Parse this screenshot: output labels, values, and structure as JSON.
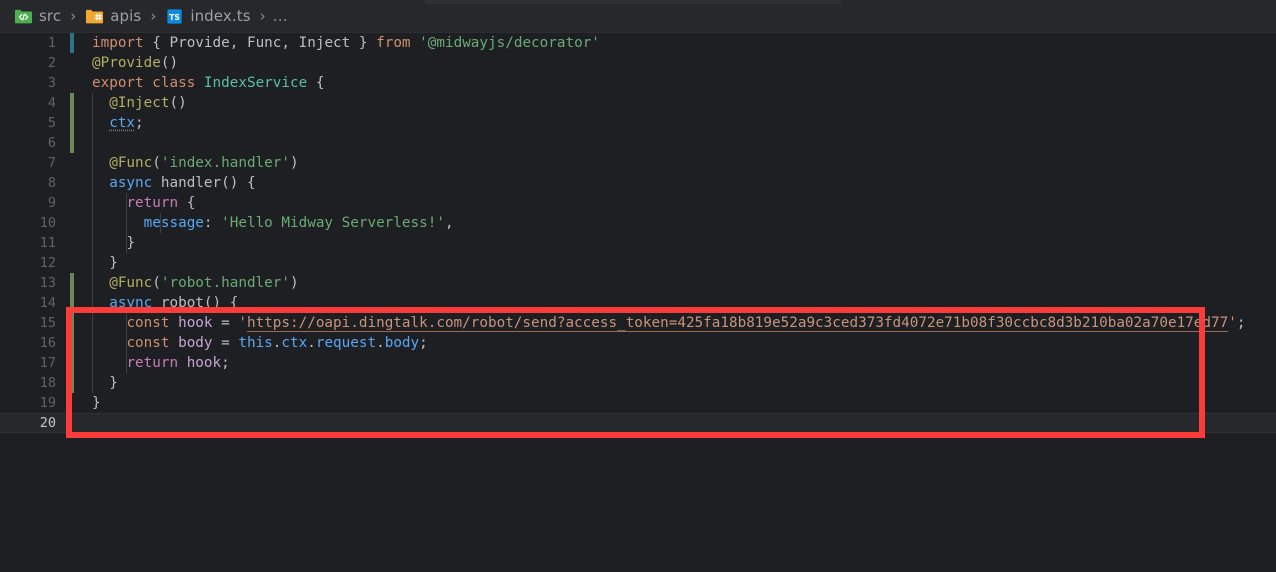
{
  "window": {
    "title": "index.ts"
  },
  "breadcrumb": {
    "items": [
      {
        "label": "src",
        "icon": "folder-src-icon"
      },
      {
        "label": "apis",
        "icon": "folder-apis-icon"
      },
      {
        "label": "index.ts",
        "icon": "typescript-file-icon"
      },
      {
        "label": "…",
        "icon": "ellipsis-icon"
      }
    ],
    "separator": "›"
  },
  "colors": {
    "editor_background": "#1e1f22",
    "breadcrumb_background": "#26282c",
    "annotation_red": "#fc3b3b",
    "gutter_modified": "#2b7489",
    "gutter_added": "#6a8759",
    "active_line": "#26282c",
    "string_green": "#6aab73",
    "string_url": "#c9937a",
    "keyword_orange": "#cf8e6d",
    "decorator_yellow": "#b3ae60",
    "class_teal": "#5bc0a8",
    "field_blue": "#56a8f5",
    "keyword_magenta": "#c77dbb"
  },
  "editor": {
    "active_line_number": 20,
    "annotation": {
      "name": "red-highlight-rectangle",
      "covers_lines": [
        13,
        14,
        15,
        16,
        17,
        18
      ]
    },
    "lines": [
      {
        "n": "1",
        "marker": "modified",
        "text": "import { Provide, Func, Inject } from '@midwayjs/decorator'"
      },
      {
        "n": "2",
        "marker": "none",
        "text": "@Provide()"
      },
      {
        "n": "3",
        "marker": "none",
        "text": "export class IndexService {"
      },
      {
        "n": "4",
        "marker": "added",
        "text": "  @Inject()"
      },
      {
        "n": "5",
        "marker": "added",
        "text": "  ctx;"
      },
      {
        "n": "6",
        "marker": "added",
        "text": ""
      },
      {
        "n": "7",
        "marker": "none",
        "text": "  @Func('index.handler')"
      },
      {
        "n": "8",
        "marker": "none",
        "text": "  async handler() {"
      },
      {
        "n": "9",
        "marker": "none",
        "text": "    return {"
      },
      {
        "n": "10",
        "marker": "none",
        "text": "      message: 'Hello Midway Serverless!',"
      },
      {
        "n": "11",
        "marker": "none",
        "text": "    }"
      },
      {
        "n": "12",
        "marker": "none",
        "text": "  }"
      },
      {
        "n": "13",
        "marker": "added",
        "text": "  @Func('robot.handler')"
      },
      {
        "n": "14",
        "marker": "added",
        "text": "  async robot() {"
      },
      {
        "n": "15",
        "marker": "added",
        "text": "    const hook = 'https://oapi.dingtalk.com/robot/send?access_token=425fa18b819e52a9c3ced373fd4072e71b08f30ccbc8d3b210ba02a70e17ed77';"
      },
      {
        "n": "16",
        "marker": "added",
        "text": "    const body = this.ctx.request.body;"
      },
      {
        "n": "17",
        "marker": "added",
        "text": "    return hook;"
      },
      {
        "n": "18",
        "marker": "added",
        "text": "  }"
      },
      {
        "n": "19",
        "marker": "none",
        "text": "}"
      },
      {
        "n": "20",
        "marker": "none",
        "text": ""
      }
    ],
    "url_value": "https://oapi.dingtalk.com/robot/send?access_token=425fa18b819e52a9c3ced373fd4072e71b08f30ccbc8d3b210ba02a70e17ed77",
    "tokens": {
      "import": "import",
      "from": "from",
      "export": "export",
      "class": "class",
      "async": "async",
      "const": "const",
      "return": "return",
      "this": "this",
      "class_name": "IndexService",
      "decorator_provide": "@Provide()",
      "decorator_inject": "@Inject()",
      "decorator_func_index": "@Func",
      "decorator_func_robot": "@Func",
      "module_path": "'@midwayjs/decorator'",
      "named_imports": "Provide, Func, Inject",
      "index_handler_arg": "'index.handler'",
      "robot_handler_arg": "'robot.handler'",
      "handler_name": "handler",
      "robot_name": "robot",
      "message_key": "message",
      "message_value": "'Hello Midway Serverless!'",
      "ctx_field": "ctx",
      "hook_var": "hook",
      "body_var": "body",
      "request_chain": "this.ctx.request.body"
    }
  }
}
